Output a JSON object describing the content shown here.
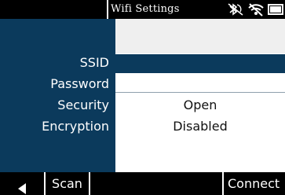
{
  "statusbar": {
    "title": "Wifi Settings",
    "icons": [
      "bluetooth-off-icon",
      "wifi-off-icon",
      "battery-icon"
    ]
  },
  "form": {
    "labels": {
      "ssid": "SSID",
      "password": "Password",
      "security": "Security",
      "encryption": "Encryption"
    },
    "values": {
      "ssid": "",
      "password": "",
      "security": "Open",
      "encryption": "Disabled"
    }
  },
  "softkeys": {
    "back_icon": "left-arrow-icon",
    "scan": "Scan",
    "connect": "Connect"
  },
  "colors": {
    "panel": "#0b3a5c",
    "bar": "#000000",
    "band": "#efefef"
  }
}
